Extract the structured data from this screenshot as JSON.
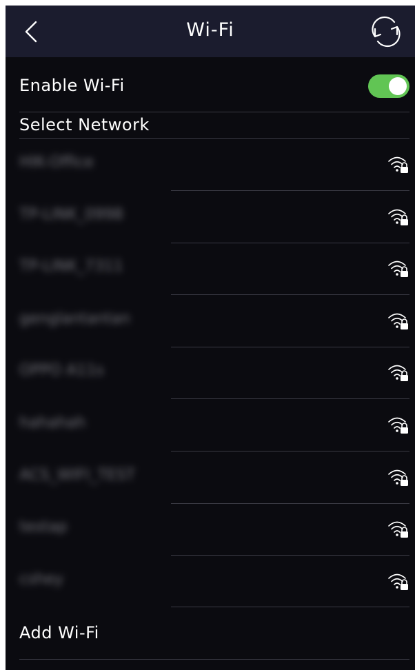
{
  "header": {
    "title": "Wi-Fi",
    "back_icon": "chevron-left-icon",
    "refresh_icon": "refresh-icon"
  },
  "settings": {
    "enable_label": "Enable Wi-Fi",
    "enable_on": true,
    "select_label": "Select Network",
    "add_label": "Add Wi-Fi"
  },
  "networks": [
    {
      "ssid": "HIK-Office",
      "secured": true
    },
    {
      "ssid": "TP-LINK_0998",
      "secured": true
    },
    {
      "ssid": "TP-LINK_7311",
      "secured": true
    },
    {
      "ssid": "genglantantan",
      "secured": true
    },
    {
      "ssid": "OPPO A11s",
      "secured": true
    },
    {
      "ssid": "hahahah",
      "secured": true
    },
    {
      "ssid": "ACS_WIFI_TEST",
      "secured": true
    },
    {
      "ssid": "testap",
      "secured": true
    },
    {
      "ssid": "cshey",
      "secured": true
    }
  ],
  "colors": {
    "header_bg": "#1b1c2e",
    "page_bg": "#0b0b10",
    "toggle_on": "#61c554",
    "separator": "#3a3a44"
  }
}
